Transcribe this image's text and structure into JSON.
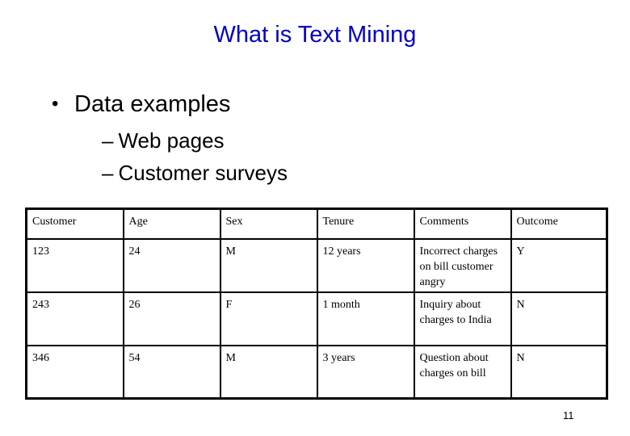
{
  "slide": {
    "title": "What is Text Mining",
    "title_color": "#0000c8",
    "bullets": [
      {
        "marker": "•",
        "text": "Data examples",
        "children": [
          {
            "marker": "–",
            "text": "Web pages"
          },
          {
            "marker": "–",
            "text": "Customer surveys"
          }
        ]
      }
    ],
    "page_number": "11"
  },
  "table": {
    "columns": [
      "Customer",
      "Age",
      "Sex",
      "Tenure",
      "Comments",
      "Outcome"
    ],
    "rows": [
      [
        "123",
        "24",
        "M",
        "12 years",
        "Incorrect charges on bill customer angry",
        "Y"
      ],
      [
        "243",
        "26",
        "F",
        "1 month",
        "Inquiry about charges to India",
        "N"
      ],
      [
        "346",
        "54",
        "M",
        "3 years",
        "Question about charges on bill",
        "N"
      ]
    ]
  }
}
